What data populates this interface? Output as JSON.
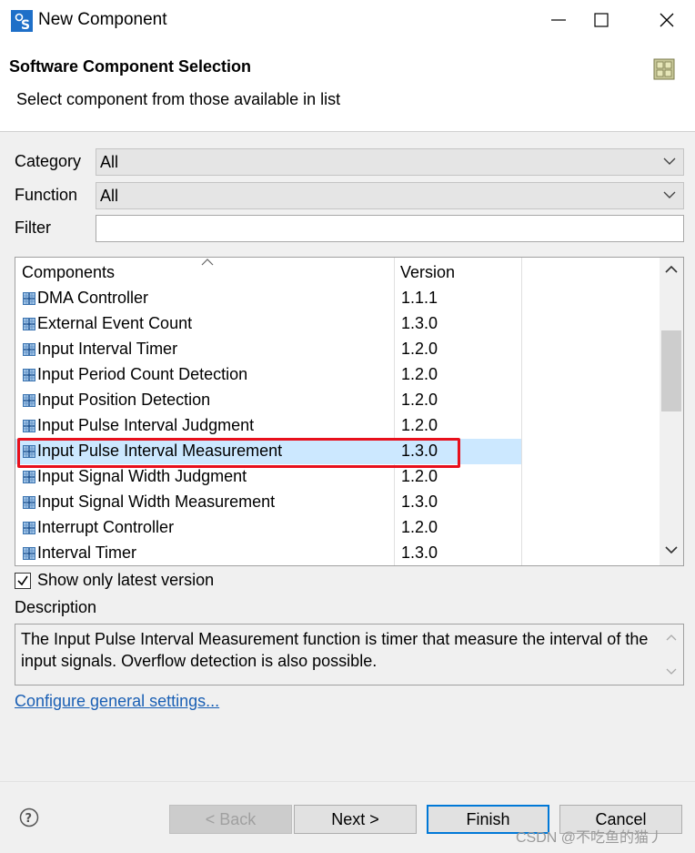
{
  "window": {
    "title": "New Component",
    "icon": "app-s-icon"
  },
  "header": {
    "title": "Software Component Selection",
    "subtitle": "Select component from those available in list",
    "icon": "grid-icon"
  },
  "filters": {
    "category_label": "Category",
    "category_value": "All",
    "function_label": "Function",
    "function_value": "All",
    "filter_label": "Filter",
    "filter_value": ""
  },
  "table": {
    "columns": [
      "Components",
      "Version"
    ],
    "rows": [
      {
        "name": "DMA Controller",
        "version": "1.1.1"
      },
      {
        "name": "External Event Count",
        "version": "1.3.0"
      },
      {
        "name": "Input Interval Timer",
        "version": "1.2.0"
      },
      {
        "name": "Input Period Count Detection",
        "version": "1.2.0"
      },
      {
        "name": "Input Position Detection",
        "version": "1.2.0"
      },
      {
        "name": "Input Pulse Interval Judgment",
        "version": "1.2.0"
      },
      {
        "name": "Input Pulse Interval Measurement",
        "version": "1.3.0"
      },
      {
        "name": "Input Signal Width Judgment",
        "version": "1.2.0"
      },
      {
        "name": "Input Signal Width Measurement",
        "version": "1.3.0"
      },
      {
        "name": "Interrupt Controller",
        "version": "1.2.0"
      },
      {
        "name": "Interval Timer",
        "version": "1.3.0"
      }
    ],
    "selected_index": 6,
    "highlight_color": "#e8101c",
    "selection_color": "#cce8ff"
  },
  "options": {
    "latest_version_label": "Show only latest version",
    "latest_version_checked": true
  },
  "description": {
    "label": "Description",
    "text": "The Input Pulse Interval Measurement function is timer that measure the interval of the input signals. Overflow detection is also possible."
  },
  "link": {
    "label": "Configure general settings..."
  },
  "buttons": {
    "back": "< Back",
    "next": "Next >",
    "finish": "Finish",
    "cancel": "Cancel"
  },
  "watermark": "CSDN @不吃鱼的猫丿"
}
